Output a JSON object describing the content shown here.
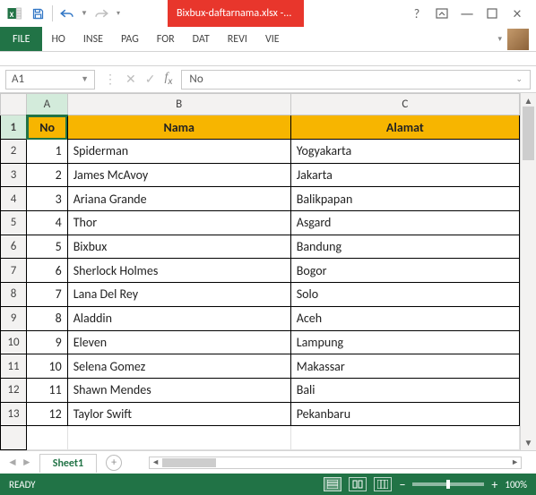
{
  "titlebar": {
    "doc_title": "Bixbux-daftarnama.xlsx -..."
  },
  "ribbon": {
    "file": "FILE",
    "tabs": [
      "HO",
      "INSE",
      "PAG",
      "FOR",
      "DAT",
      "REVI",
      "VIE"
    ]
  },
  "formula_bar": {
    "namebox": "A1",
    "value": "No"
  },
  "columns": [
    "A",
    "B",
    "C"
  ],
  "headers": {
    "no": "No",
    "nama": "Nama",
    "alamat": "Alamat"
  },
  "rows": [
    {
      "no": "1",
      "nama": "Spiderman",
      "alamat": "Yogyakarta"
    },
    {
      "no": "2",
      "nama": "James McAvoy",
      "alamat": "Jakarta"
    },
    {
      "no": "3",
      "nama": "Ariana Grande",
      "alamat": "Balikpapan"
    },
    {
      "no": "4",
      "nama": "Thor",
      "alamat": "Asgard"
    },
    {
      "no": "5",
      "nama": "Bixbux",
      "alamat": "Bandung"
    },
    {
      "no": "6",
      "nama": "Sherlock Holmes",
      "alamat": "Bogor"
    },
    {
      "no": "7",
      "nama": "Lana Del Rey",
      "alamat": "Solo"
    },
    {
      "no": "8",
      "nama": "Aladdin",
      "alamat": "Aceh"
    },
    {
      "no": "9",
      "nama": "Eleven",
      "alamat": "Lampung"
    },
    {
      "no": "10",
      "nama": "Selena Gomez",
      "alamat": "Makassar"
    },
    {
      "no": "11",
      "nama": "Shawn Mendes",
      "alamat": "Bali"
    },
    {
      "no": "12",
      "nama": "Taylor Swift",
      "alamat": "Pekanbaru"
    }
  ],
  "sheet": {
    "active": "Sheet1"
  },
  "status": {
    "state": "READY",
    "zoom": "100%"
  }
}
